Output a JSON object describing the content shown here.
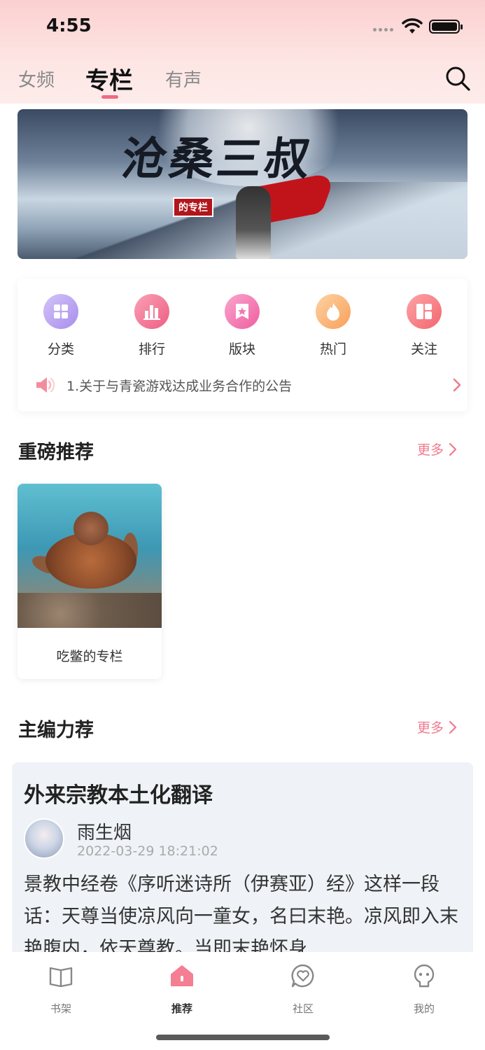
{
  "status_bar": {
    "time": "4:55"
  },
  "top_tabs": [
    {
      "label": "女频",
      "active": false
    },
    {
      "label": "专栏",
      "active": true
    },
    {
      "label": "有声",
      "active": false
    }
  ],
  "banner": {
    "title": "沧桑三叔",
    "tag": "的专栏"
  },
  "menu": [
    {
      "label": "分类",
      "icon": "grid-icon",
      "color": "#b9a6f0"
    },
    {
      "label": "排行",
      "icon": "bar-chart-icon",
      "color": "#f27e9b"
    },
    {
      "label": "版块",
      "icon": "bookmark-star-icon",
      "color": "#f57cb0"
    },
    {
      "label": "热门",
      "icon": "flame-icon",
      "color": "#fbb56e"
    },
    {
      "label": "关注",
      "icon": "layout-icon",
      "color": "#f67a7f"
    }
  ],
  "notice": {
    "text": "1.关于与青瓷游戏达成业务合作的公告"
  },
  "featured": {
    "title": "重磅推荐",
    "more": "更多",
    "items": [
      {
        "title": "吃鳖的专栏"
      }
    ]
  },
  "editor_pick": {
    "title": "主编力荐",
    "more": "更多",
    "article": {
      "title": "外来宗教本土化翻译",
      "author": "雨生烟",
      "date": "2022-03-29 18:21:02",
      "body": "景教中经卷《序听迷诗所（伊赛亚）经》这样一段话：天尊当使凉风向一童女，名曰末艳。凉风即入末艳腹内，依天尊教。当即末艳怀身"
    }
  },
  "bottom_nav": [
    {
      "label": "书架",
      "icon": "book-icon",
      "active": false
    },
    {
      "label": "推荐",
      "icon": "home-icon",
      "active": true
    },
    {
      "label": "社区",
      "icon": "chat-heart-icon",
      "active": false
    },
    {
      "label": "我的",
      "icon": "user-icon",
      "active": false
    }
  ],
  "colors": {
    "accent": "#f06a83",
    "more_link": "#f07a8e"
  }
}
